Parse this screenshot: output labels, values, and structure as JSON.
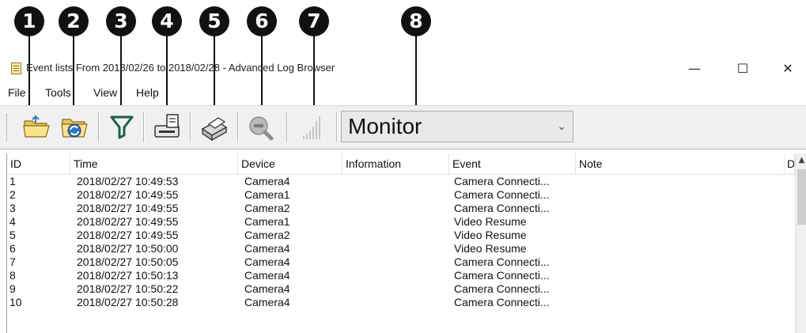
{
  "callouts": [
    "1",
    "2",
    "3",
    "4",
    "5",
    "6",
    "7",
    "8"
  ],
  "window": {
    "title": "Event lists From 2018/02/26 to 2018/02/28 - Advanced Log Browser",
    "minimize": "—",
    "maximize": "☐",
    "close": "✕"
  },
  "menu": [
    "File",
    "Tools",
    "View",
    "Help"
  ],
  "toolbar": {
    "buttons": [
      "open-folder-icon",
      "refresh-folder-icon",
      "filter-icon",
      "export-icon",
      "print-icon",
      "search-icon",
      "chart-icon"
    ],
    "combo_value": "Monitor",
    "combo_arrow": "⌄"
  },
  "table": {
    "columns": [
      "ID",
      "Time",
      "Device",
      "Information",
      "Event",
      "Note",
      "D"
    ],
    "rows": [
      [
        "1",
        "2018/02/27 10:49:53",
        "Camera4",
        "",
        "Camera Connecti..."
      ],
      [
        "2",
        "2018/02/27 10:49:55",
        "Camera1",
        "",
        "Camera Connecti..."
      ],
      [
        "3",
        "2018/02/27 10:49:55",
        "Camera2",
        "",
        "Camera Connecti..."
      ],
      [
        "4",
        "2018/02/27 10:49:55",
        "Camera1",
        "",
        "Video Resume"
      ],
      [
        "5",
        "2018/02/27 10:49:55",
        "Camera2",
        "",
        "Video Resume"
      ],
      [
        "6",
        "2018/02/27 10:50:00",
        "Camera4",
        "",
        "Video Resume"
      ],
      [
        "7",
        "2018/02/27 10:50:05",
        "Camera4",
        "",
        "Camera Connecti..."
      ],
      [
        "8",
        "2018/02/27 10:50:13",
        "Camera4",
        "",
        "Camera Connecti..."
      ],
      [
        "9",
        "2018/02/27 10:50:22",
        "Camera4",
        "",
        "Camera Connecti..."
      ],
      [
        "10",
        "2018/02/27 10:50:28",
        "Camera4",
        "",
        "Camera Connecti..."
      ]
    ],
    "scroll_up": "▲"
  }
}
